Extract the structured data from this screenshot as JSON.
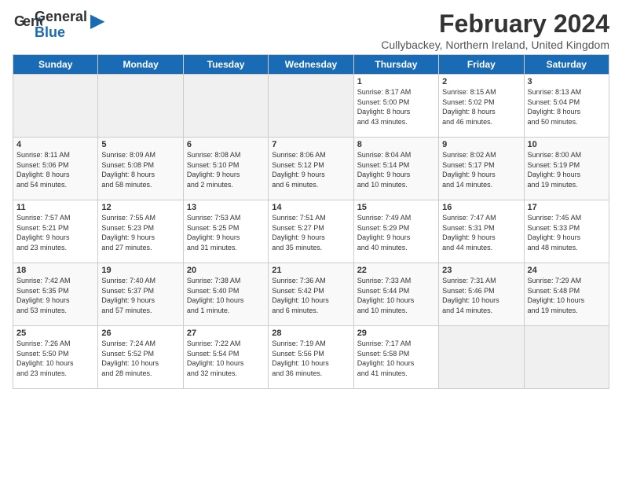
{
  "header": {
    "logo_line1": "General",
    "logo_line2": "Blue",
    "title": "February 2024",
    "subtitle": "Cullybackey, Northern Ireland, United Kingdom"
  },
  "calendar": {
    "days_of_week": [
      "Sunday",
      "Monday",
      "Tuesday",
      "Wednesday",
      "Thursday",
      "Friday",
      "Saturday"
    ],
    "weeks": [
      [
        {
          "day": "",
          "info": ""
        },
        {
          "day": "",
          "info": ""
        },
        {
          "day": "",
          "info": ""
        },
        {
          "day": "",
          "info": ""
        },
        {
          "day": "1",
          "info": "Sunrise: 8:17 AM\nSunset: 5:00 PM\nDaylight: 8 hours\nand 43 minutes."
        },
        {
          "day": "2",
          "info": "Sunrise: 8:15 AM\nSunset: 5:02 PM\nDaylight: 8 hours\nand 46 minutes."
        },
        {
          "day": "3",
          "info": "Sunrise: 8:13 AM\nSunset: 5:04 PM\nDaylight: 8 hours\nand 50 minutes."
        }
      ],
      [
        {
          "day": "4",
          "info": "Sunrise: 8:11 AM\nSunset: 5:06 PM\nDaylight: 8 hours\nand 54 minutes."
        },
        {
          "day": "5",
          "info": "Sunrise: 8:09 AM\nSunset: 5:08 PM\nDaylight: 8 hours\nand 58 minutes."
        },
        {
          "day": "6",
          "info": "Sunrise: 8:08 AM\nSunset: 5:10 PM\nDaylight: 9 hours\nand 2 minutes."
        },
        {
          "day": "7",
          "info": "Sunrise: 8:06 AM\nSunset: 5:12 PM\nDaylight: 9 hours\nand 6 minutes."
        },
        {
          "day": "8",
          "info": "Sunrise: 8:04 AM\nSunset: 5:14 PM\nDaylight: 9 hours\nand 10 minutes."
        },
        {
          "day": "9",
          "info": "Sunrise: 8:02 AM\nSunset: 5:17 PM\nDaylight: 9 hours\nand 14 minutes."
        },
        {
          "day": "10",
          "info": "Sunrise: 8:00 AM\nSunset: 5:19 PM\nDaylight: 9 hours\nand 19 minutes."
        }
      ],
      [
        {
          "day": "11",
          "info": "Sunrise: 7:57 AM\nSunset: 5:21 PM\nDaylight: 9 hours\nand 23 minutes."
        },
        {
          "day": "12",
          "info": "Sunrise: 7:55 AM\nSunset: 5:23 PM\nDaylight: 9 hours\nand 27 minutes."
        },
        {
          "day": "13",
          "info": "Sunrise: 7:53 AM\nSunset: 5:25 PM\nDaylight: 9 hours\nand 31 minutes."
        },
        {
          "day": "14",
          "info": "Sunrise: 7:51 AM\nSunset: 5:27 PM\nDaylight: 9 hours\nand 35 minutes."
        },
        {
          "day": "15",
          "info": "Sunrise: 7:49 AM\nSunset: 5:29 PM\nDaylight: 9 hours\nand 40 minutes."
        },
        {
          "day": "16",
          "info": "Sunrise: 7:47 AM\nSunset: 5:31 PM\nDaylight: 9 hours\nand 44 minutes."
        },
        {
          "day": "17",
          "info": "Sunrise: 7:45 AM\nSunset: 5:33 PM\nDaylight: 9 hours\nand 48 minutes."
        }
      ],
      [
        {
          "day": "18",
          "info": "Sunrise: 7:42 AM\nSunset: 5:35 PM\nDaylight: 9 hours\nand 53 minutes."
        },
        {
          "day": "19",
          "info": "Sunrise: 7:40 AM\nSunset: 5:37 PM\nDaylight: 9 hours\nand 57 minutes."
        },
        {
          "day": "20",
          "info": "Sunrise: 7:38 AM\nSunset: 5:40 PM\nDaylight: 10 hours\nand 1 minute."
        },
        {
          "day": "21",
          "info": "Sunrise: 7:36 AM\nSunset: 5:42 PM\nDaylight: 10 hours\nand 6 minutes."
        },
        {
          "day": "22",
          "info": "Sunrise: 7:33 AM\nSunset: 5:44 PM\nDaylight: 10 hours\nand 10 minutes."
        },
        {
          "day": "23",
          "info": "Sunrise: 7:31 AM\nSunset: 5:46 PM\nDaylight: 10 hours\nand 14 minutes."
        },
        {
          "day": "24",
          "info": "Sunrise: 7:29 AM\nSunset: 5:48 PM\nDaylight: 10 hours\nand 19 minutes."
        }
      ],
      [
        {
          "day": "25",
          "info": "Sunrise: 7:26 AM\nSunset: 5:50 PM\nDaylight: 10 hours\nand 23 minutes."
        },
        {
          "day": "26",
          "info": "Sunrise: 7:24 AM\nSunset: 5:52 PM\nDaylight: 10 hours\nand 28 minutes."
        },
        {
          "day": "27",
          "info": "Sunrise: 7:22 AM\nSunset: 5:54 PM\nDaylight: 10 hours\nand 32 minutes."
        },
        {
          "day": "28",
          "info": "Sunrise: 7:19 AM\nSunset: 5:56 PM\nDaylight: 10 hours\nand 36 minutes."
        },
        {
          "day": "29",
          "info": "Sunrise: 7:17 AM\nSunset: 5:58 PM\nDaylight: 10 hours\nand 41 minutes."
        },
        {
          "day": "",
          "info": ""
        },
        {
          "day": "",
          "info": ""
        }
      ]
    ]
  }
}
